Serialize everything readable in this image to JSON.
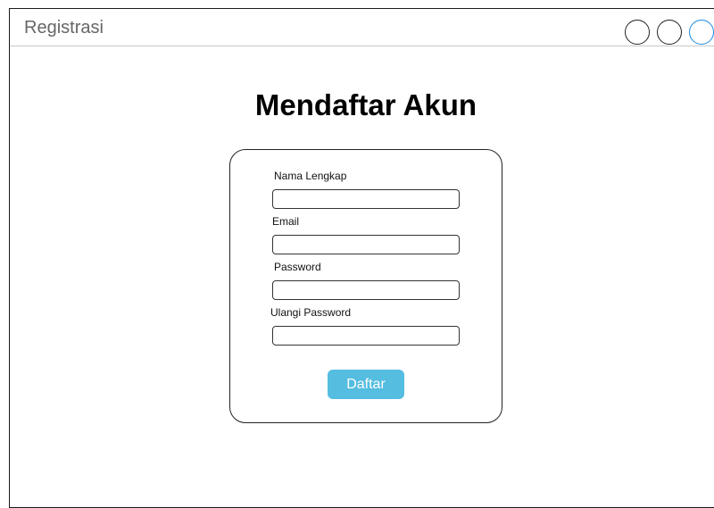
{
  "window": {
    "title": "Registrasi"
  },
  "page": {
    "heading": "Mendaftar Akun"
  },
  "form": {
    "fields": [
      {
        "label": "Nama Lengkap",
        "value": "",
        "placeholder": ""
      },
      {
        "label": "Email",
        "value": "",
        "placeholder": ""
      },
      {
        "label": "Password",
        "value": "",
        "placeholder": ""
      },
      {
        "label": "Ulangi Password",
        "value": "",
        "placeholder": ""
      }
    ],
    "submit_label": "Daftar"
  },
  "colors": {
    "accent_button": "#54bde0",
    "window_control_active": "#1b8be0",
    "title_text": "#666666"
  }
}
